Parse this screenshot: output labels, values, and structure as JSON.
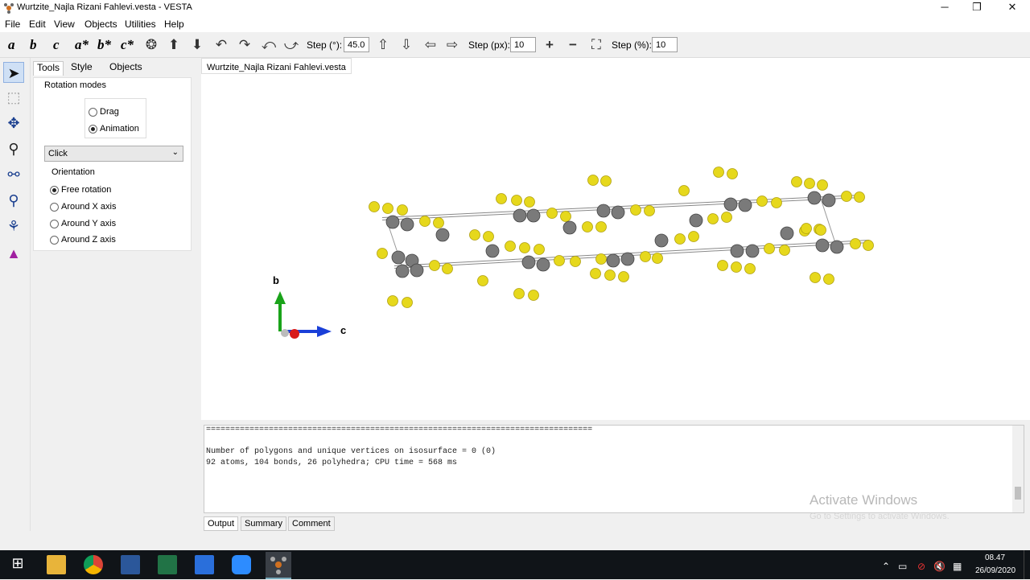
{
  "window": {
    "title": "Wurtzite_Najla Rizani Fahlevi.vesta - VESTA",
    "minimize": "─",
    "restore": "❐",
    "close": "✕"
  },
  "menu": [
    "File",
    "Edit",
    "View",
    "Objects",
    "Utilities",
    "Help"
  ],
  "toolbar": {
    "axes": [
      "a",
      "b",
      "c",
      "a*",
      "b*",
      "c*"
    ],
    "step_deg_label": "Step (°):",
    "step_deg_value": "45.0",
    "step_px_label": "Step (px):",
    "step_px_value": "10",
    "step_pct_label": "Step (%):",
    "step_pct_value": "10"
  },
  "panel": {
    "tabs": [
      "Tools",
      "Style",
      "Objects"
    ],
    "rotation_modes_label": "Rotation modes",
    "modes": [
      {
        "label": "Drag",
        "selected": false
      },
      {
        "label": "Animation",
        "selected": true
      }
    ],
    "click_select": "Click",
    "orientation_label": "Orientation",
    "orientations": [
      {
        "label": "Free rotation",
        "selected": true
      },
      {
        "label": "Around X axis",
        "selected": false
      },
      {
        "label": "Around Y axis",
        "selected": false
      },
      {
        "label": "Around Z axis",
        "selected": false
      }
    ]
  },
  "document_tab": "Wurtzite_Najla Rizani Fahlevi.vesta",
  "axis_labels": {
    "b": "b",
    "c": "c"
  },
  "output": {
    "separator": "================================================================================",
    "line1": "Number of polygons and unique vertices on isosurface = 0 (0)",
    "line2": "92 atoms, 104 bonds, 26 polyhedra; CPU time = 568 ms"
  },
  "bottom_tabs": [
    "Output",
    "Summary",
    "Comment"
  ],
  "watermark": {
    "title": "Activate Windows",
    "subtitle": "Go to Settings to activate Windows."
  },
  "taskbar": {
    "time": "08.47",
    "date": "26/09/2020"
  },
  "colors": {
    "sulfur": "#e6d81c",
    "zinc": "#7a7a7a",
    "axis_b": "#1aa31a",
    "axis_c": "#1a3fd8",
    "axis_a": "#d81a1a"
  }
}
